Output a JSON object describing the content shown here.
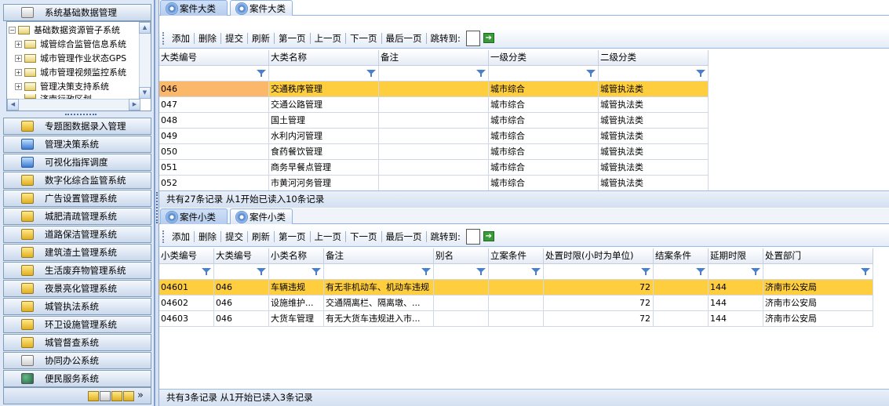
{
  "sidebar": {
    "top_item": "系统基础数据管理",
    "tree": {
      "root": "基础数据资源管子系统",
      "children": [
        "城管综合监管信息系统",
        "城市管理作业状态GPS",
        "城市管理视频监控系统",
        "管理决策支持系统",
        "济南行政区划"
      ]
    },
    "items": [
      "专题图数据录入管理",
      "管理决策系统",
      "可视化指挥调度",
      "数字化综合监管系统",
      "广告设置管理系统",
      "城肥清疏管理系统",
      "道路保洁管理系统",
      "建筑渣土管理系统",
      "生活废弃物管理系统",
      "夜景亮化管理系统",
      "城管执法系统",
      "环卫设施管理系统",
      "城管督查系统",
      "协同办公系统",
      "便民服务系统"
    ],
    "more": "»"
  },
  "top_panel": {
    "tabs": [
      "案件大类",
      "案件大类"
    ],
    "toolbar": [
      "添加",
      "删除",
      "提交",
      "刷新",
      "第一页",
      "上一页",
      "下一页",
      "最后一页",
      "跳转到:"
    ],
    "columns": [
      "大类编号",
      "大类名称",
      "备注",
      "一级分类",
      "二级分类"
    ],
    "rows": [
      [
        "046",
        "交通秩序管理",
        "",
        "城市综合",
        "城管执法类"
      ],
      [
        "047",
        "交通公路管理",
        "",
        "城市综合",
        "城管执法类"
      ],
      [
        "048",
        "国土管理",
        "",
        "城市综合",
        "城管执法类"
      ],
      [
        "049",
        "水利内河管理",
        "",
        "城市综合",
        "城管执法类"
      ],
      [
        "050",
        "食药餐饮管理",
        "",
        "城市综合",
        "城管执法类"
      ],
      [
        "051",
        "商务早餐点管理",
        "",
        "城市综合",
        "城管执法类"
      ],
      [
        "052",
        "市黄河河务管理",
        "",
        "城市综合",
        "城管执法类"
      ]
    ],
    "status": "共有27条记录 从1开始已读入10条记录"
  },
  "bottom_panel": {
    "tabs": [
      "案件小类",
      "案件小类"
    ],
    "toolbar": [
      "添加",
      "删除",
      "提交",
      "刷新",
      "第一页",
      "上一页",
      "下一页",
      "最后一页",
      "跳转到:"
    ],
    "columns": [
      "小类编号",
      "大类编号",
      "小类名称",
      "备注",
      "别名",
      "立案条件",
      "处置时限(小时为单位)",
      "结案条件",
      "延期时限",
      "处置部门"
    ],
    "rows": [
      [
        "04601",
        "046",
        "车辆违规",
        "有无非机动车、机动车违规",
        "",
        "",
        "72",
        "",
        "144",
        "济南市公安局"
      ],
      [
        "04602",
        "046",
        "设施维护...",
        "交通隔离栏、隔离墩、...",
        "",
        "",
        "72",
        "",
        "144",
        "济南市公安局"
      ],
      [
        "04603",
        "046",
        "大货车管理",
        "有无大货车违规进入市...",
        "",
        "",
        "72",
        "",
        "144",
        "济南市公安局"
      ]
    ],
    "status": "共有3条记录 从1开始已读入3条记录"
  },
  "colors": {
    "selected_row": "#ffce3e",
    "first_cell_selected": "#fbb86a",
    "header_bg": "#dfe8f6"
  }
}
